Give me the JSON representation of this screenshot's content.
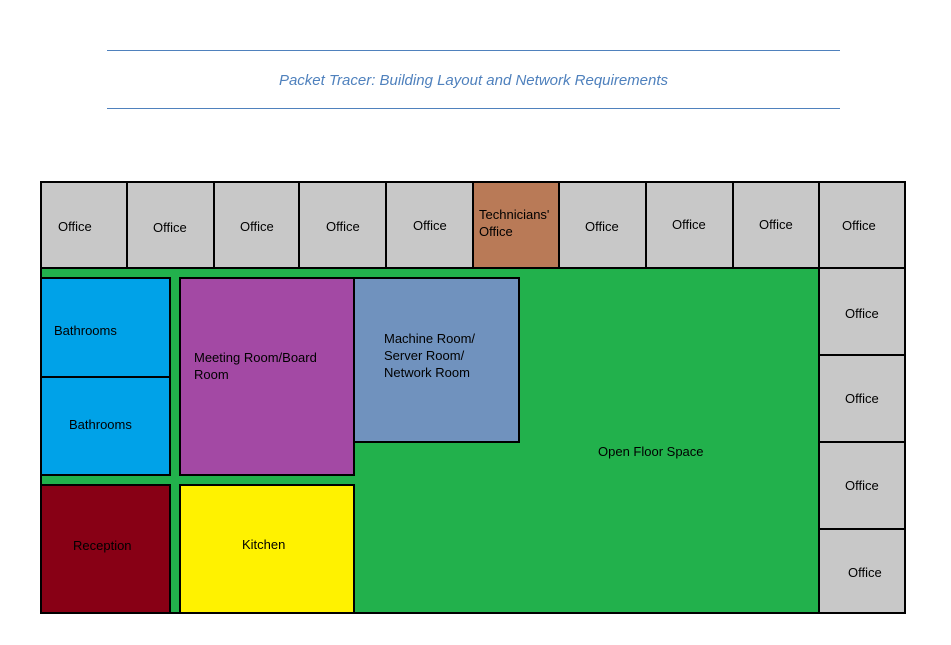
{
  "header": {
    "title": "Packet Tracer: Building Layout and Network Requirements"
  },
  "colors": {
    "office": "#c8c8c8",
    "technicians_office": "#b97a57",
    "bathrooms": "#00a2e8",
    "meeting_room": "#a349a4",
    "machine_room": "#7092be",
    "open_floor": "#22b14c",
    "reception": "#880015",
    "kitchen": "#fff200",
    "title": "#4f81bd"
  },
  "floorplan": {
    "top_offices": [
      "Office",
      "Office",
      "Office",
      "Office",
      "Office",
      "Technicians' Office",
      "Office",
      "Office",
      "Office",
      "Office"
    ],
    "right_offices": [
      "Office",
      "Office",
      "Office",
      "Office"
    ],
    "bathrooms_1": "Bathrooms",
    "bathrooms_2": "Bathrooms",
    "meeting_room": "Meeting Room/Board Room",
    "machine_room": "Machine Room/ Server Room/ Network Room",
    "open_floor": "Open Floor Space",
    "reception": "Reception",
    "kitchen": "Kitchen"
  }
}
